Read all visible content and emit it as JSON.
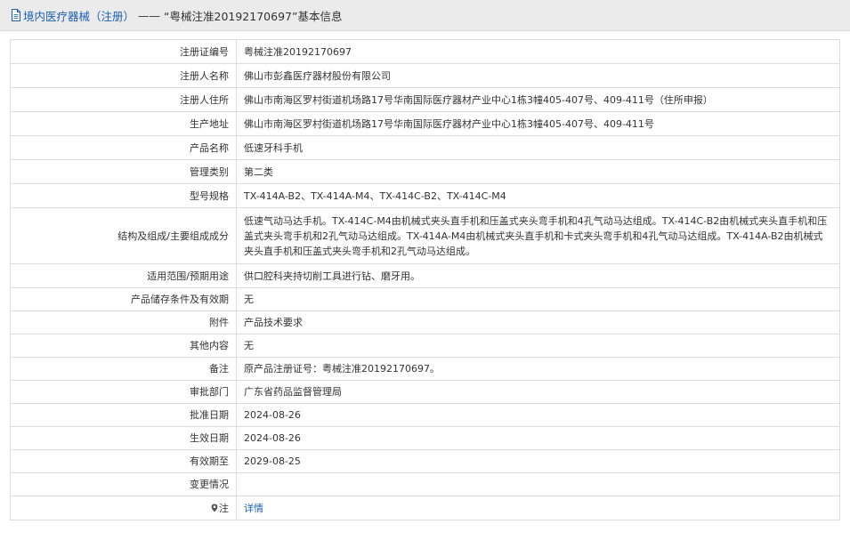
{
  "header": {
    "breadcrumb": "境内医疗器械（注册）",
    "separator": "——",
    "detail_title": "“粤械注准20192170697”基本信息"
  },
  "rows": [
    {
      "label": "注册证编号",
      "value": "粤械注准20192170697"
    },
    {
      "label": "注册人名称",
      "value": "佛山市彭鑫医疗器材股份有限公司"
    },
    {
      "label": "注册人住所",
      "value": "佛山市南海区罗村街道机场路17号华南国际医疗器材产业中心1栋3幢405-407号、409-411号（住所申报）"
    },
    {
      "label": "生产地址",
      "value": "佛山市南海区罗村街道机场路17号华南国际医疗器材产业中心1栋3幢405-407号、409-411号"
    },
    {
      "label": "产品名称",
      "value": "低速牙科手机"
    },
    {
      "label": "管理类别",
      "value": "第二类"
    },
    {
      "label": "型号规格",
      "value": "TX-414A-B2、TX-414A-M4、TX-414C-B2、TX-414C-M4"
    },
    {
      "label": "结构及组成/主要组成成分",
      "value": "低速气动马达手机。TX-414C-M4由机械式夹头直手机和压盖式夹头弯手机和4孔气动马达组成。TX-414C-B2由机械式夹头直手机和压盖式夹头弯手机和2孔气动马达组成。TX-414A-M4由机械式夹头直手机和卡式夹头弯手机和4孔气动马达组成。TX-414A-B2由机械式夹头直手机和压盖式夹头弯手机和2孔气动马达组成。"
    },
    {
      "label": "适用范围/预期用途",
      "value": "供口腔科夹持切削工具进行钻、磨牙用。"
    },
    {
      "label": "产品储存条件及有效期",
      "value": "无"
    },
    {
      "label": "附件",
      "value": "产品技术要求"
    },
    {
      "label": "其他内容",
      "value": "无"
    },
    {
      "label": "备注",
      "value": "原产品注册证号：粤械注准20192170697。"
    },
    {
      "label": "审批部门",
      "value": "广东省药品监督管理局"
    },
    {
      "label": "批准日期",
      "value": "2024-08-26"
    },
    {
      "label": "生效日期",
      "value": "2024-08-26"
    },
    {
      "label": "有效期至",
      "value": "2029-08-25"
    },
    {
      "label": "变更情况",
      "value": ""
    }
  ],
  "note_row": {
    "label": "注",
    "link_text": "详情"
  },
  "icons": {
    "header": "document-icon",
    "note": "map-pin-icon"
  },
  "colors": {
    "link": "#1a5fb4",
    "header_bg": "#ebebeb",
    "border": "#dcdcdc"
  }
}
